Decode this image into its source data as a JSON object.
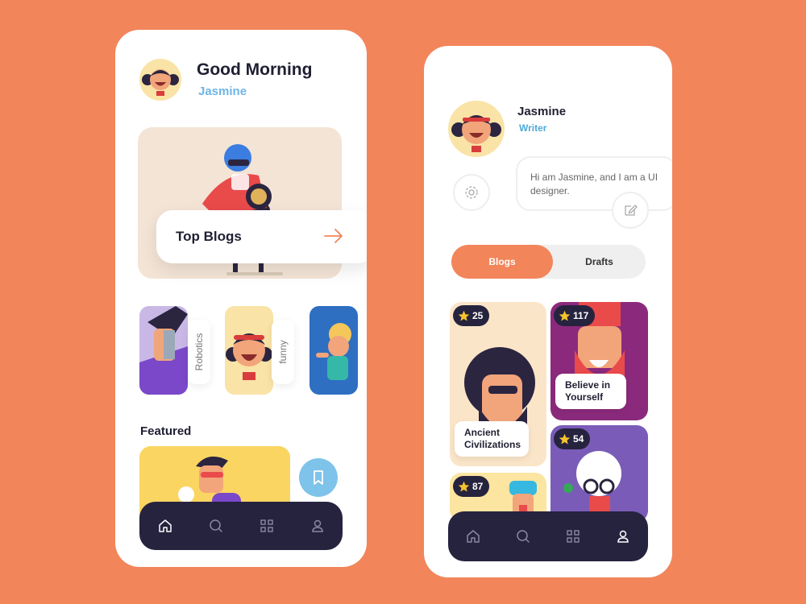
{
  "left_screen": {
    "greeting": "Good Morning",
    "user_name": "Jasmine",
    "hero_card": {
      "label": "Top Blogs"
    },
    "categories": [
      {
        "label": "Robotics"
      },
      {
        "label": "funny"
      }
    ],
    "featured_label": "Featured",
    "nav": [
      "home-icon",
      "search-icon",
      "grid-icon",
      "user-icon"
    ]
  },
  "right_screen": {
    "profile": {
      "name": "Jasmine",
      "role": "Writer",
      "bio": "Hi am Jasmine, and I am a UI designer."
    },
    "tabs": {
      "active": "Blogs",
      "inactive": "Drafts"
    },
    "blogs": [
      {
        "rating": "25",
        "title": "Ancient Civilizations"
      },
      {
        "rating": "117",
        "title": "Believe in Yourself"
      },
      {
        "rating": "54",
        "title": ""
      },
      {
        "rating": "87",
        "title": ""
      }
    ],
    "nav": [
      "home-icon",
      "search-icon",
      "grid-icon",
      "user-icon"
    ]
  },
  "colors": {
    "background": "#F2855A",
    "accent": "#F2855A",
    "nav_bar": "#26233f",
    "name_blue": "#6fb5e6"
  }
}
